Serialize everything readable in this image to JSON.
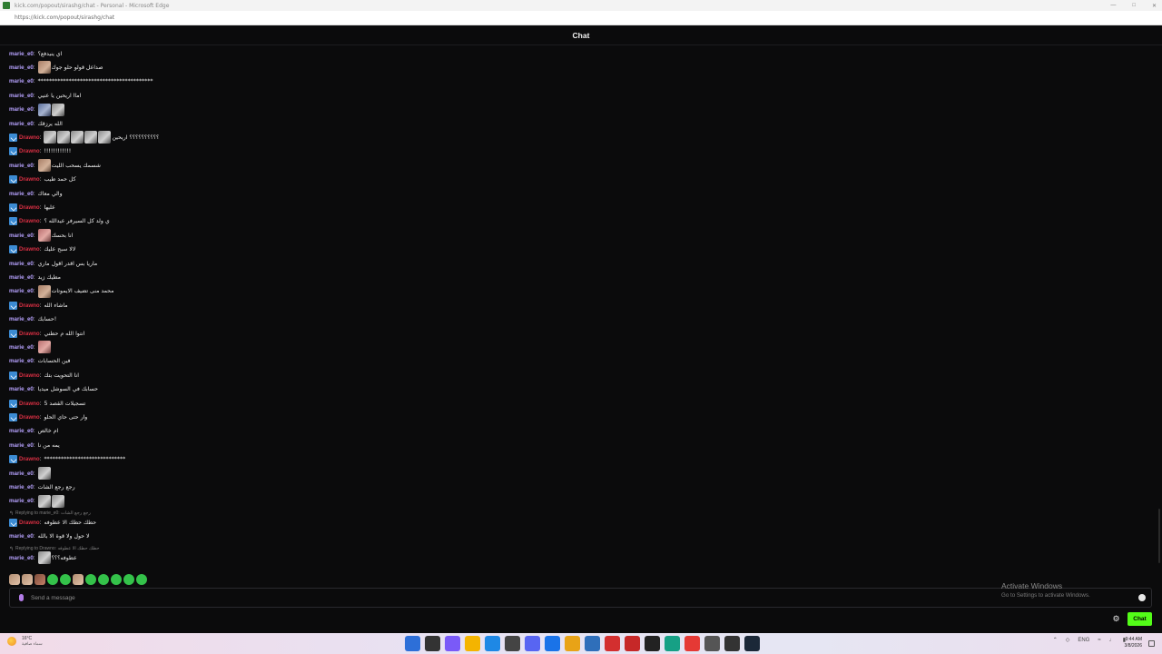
{
  "window": {
    "title": "kick.com/popout/sirashg/chat - Personal - Microsoft Edge",
    "url": "https://kick.com/popout/sirashg/chat"
  },
  "chat": {
    "title": "Chat",
    "messages": [
      {
        "user": "marie_e0",
        "badge": false,
        "text": "اي ينيدفع؟",
        "emotes": []
      },
      {
        "user": "marie_e0",
        "badge": false,
        "text": "صداعل قولو حلو جوك",
        "emotes": [
          "tan"
        ]
      },
      {
        "user": "marie_e0",
        "badge": false,
        "text": "*****************************************",
        "emotes": []
      },
      {
        "user": "marie_e0",
        "badge": false,
        "text": "اماا اريحين يا عنيي",
        "emotes": []
      },
      {
        "user": "marie_e0",
        "badge": false,
        "text": "",
        "emotes": [
          "blueish",
          "gray"
        ]
      },
      {
        "user": "marie_e0",
        "badge": false,
        "text": "الله يرزقك",
        "emotes": []
      },
      {
        "user": "Drawno",
        "badge": true,
        "text": "؟؟؟؟؟؟؟؟؟؟ اريحين",
        "emotes": [
          "gray",
          "gray",
          "gray",
          "gray",
          "gray"
        ]
      },
      {
        "user": "Drawno",
        "badge": true,
        "text": "!!!!!!!!!!!!",
        "emotes": []
      },
      {
        "user": "marie_e0",
        "badge": false,
        "text": "شسمك يسحب الليت",
        "emotes": [
          "tan"
        ]
      },
      {
        "user": "Drawno",
        "badge": true,
        "text": "كل حمد طيب",
        "emotes": []
      },
      {
        "user": "marie_e0",
        "badge": false,
        "text": "والي معاك",
        "emotes": []
      },
      {
        "user": "Drawno",
        "badge": true,
        "text": "عليها",
        "emotes": []
      },
      {
        "user": "Drawno",
        "badge": true,
        "text": "ي ولد كل السيرفر عيدالله ؟",
        "emotes": []
      },
      {
        "user": "marie_e0",
        "badge": false,
        "text": "انا بحسك",
        "emotes": [
          "pink"
        ]
      },
      {
        "user": "Drawno",
        "badge": true,
        "text": "لالا سبح عليك",
        "emotes": []
      },
      {
        "user": "marie_e0",
        "badge": false,
        "text": "ماريا بس اقدر اقول ماري",
        "emotes": []
      },
      {
        "user": "marie_e0",
        "badge": false,
        "text": "مطيك زيد",
        "emotes": []
      },
      {
        "user": "marie_e0",
        "badge": false,
        "text": "محمد منى تضيف الايموتات",
        "emotes": [
          "tan"
        ]
      },
      {
        "user": "Drawno",
        "badge": true,
        "text": "ماشاء الله",
        "emotes": []
      },
      {
        "user": "marie_e0",
        "badge": false,
        "text": "حسابك!",
        "emotes": []
      },
      {
        "user": "Drawno",
        "badge": true,
        "text": "انتوا الله م حطني",
        "emotes": []
      },
      {
        "user": "marie_e0",
        "badge": false,
        "text": "",
        "emotes": [
          "pink"
        ]
      },
      {
        "user": "marie_e0",
        "badge": false,
        "text": "فين الحسابات",
        "emotes": []
      },
      {
        "user": "Drawno",
        "badge": true,
        "text": "انا التحويت بتك",
        "emotes": []
      },
      {
        "user": "marie_e0",
        "badge": false,
        "text": "حسابك في السوشل ميديا",
        "emotes": []
      },
      {
        "user": "Drawno",
        "badge": true,
        "text": "تسجيلات القصد 5",
        "emotes": []
      },
      {
        "user": "Drawno",
        "badge": true,
        "text": "وار حتى حاي الحلو",
        "emotes": []
      },
      {
        "user": "marie_e0",
        "badge": false,
        "text": "ام خالص",
        "emotes": []
      },
      {
        "user": "marie_e0",
        "badge": false,
        "text": "يمه من نا",
        "emotes": []
      },
      {
        "user": "Drawno",
        "badge": true,
        "text": "*****************************",
        "emotes": []
      },
      {
        "user": "marie_e0",
        "badge": false,
        "text": "",
        "emotes": [
          "gray"
        ]
      },
      {
        "user": "marie_e0",
        "badge": false,
        "text": "رجع رجع الشات",
        "emotes": []
      },
      {
        "user": "marie_e0",
        "badge": false,
        "text": "",
        "emotes": [
          "gray",
          "gray"
        ]
      },
      {
        "user": "Drawno",
        "badge": true,
        "text": "حطك حطك الا عطوفه",
        "emotes": [],
        "reply": "Replying to marie_e0: رجع رجع الشات"
      },
      {
        "user": "marie_e0",
        "badge": false,
        "text": "لا حول ولا قوة الا بالله",
        "emotes": []
      },
      {
        "user": "marie_e0",
        "badge": false,
        "text": "عطوفه؟؟؟",
        "emotes": [
          "gray"
        ],
        "reply": "Replying to Drawno: حطك حطك الا عطوفه"
      }
    ],
    "input_placeholder": "Send a message",
    "send_label": "Chat",
    "emote_strip": [
      "t",
      "t",
      "r",
      "g",
      "g",
      "t",
      "g",
      "g",
      "g",
      "g",
      "g"
    ]
  },
  "colors": {
    "accent": "#53fc18",
    "marie_name": "#b7a2ff",
    "drawno_name": "#d92f43",
    "badge": "#3c8bd3"
  },
  "watermark": {
    "line1": "Activate Windows",
    "line2": "Go to Settings to activate Windows."
  },
  "taskbar": {
    "weather_temp": "16°C",
    "weather_cond": "سماء صافية",
    "lang": "ENG",
    "time": "9:44 AM",
    "date": "3/8/2026",
    "apps": [
      "windows-start-icon",
      "search-icon",
      "copilot-icon",
      "file-explorer-icon",
      "edge-icon",
      "store-icon",
      "discord-icon",
      "chrome-icon",
      "reaper-icon",
      "vscode-icon",
      "acrobat-icon",
      "pdf-icon",
      "obs-icon",
      "camtasia-icon",
      "youtube-icon",
      "settings-icon",
      "terminal-icon",
      "steam-icon"
    ]
  }
}
